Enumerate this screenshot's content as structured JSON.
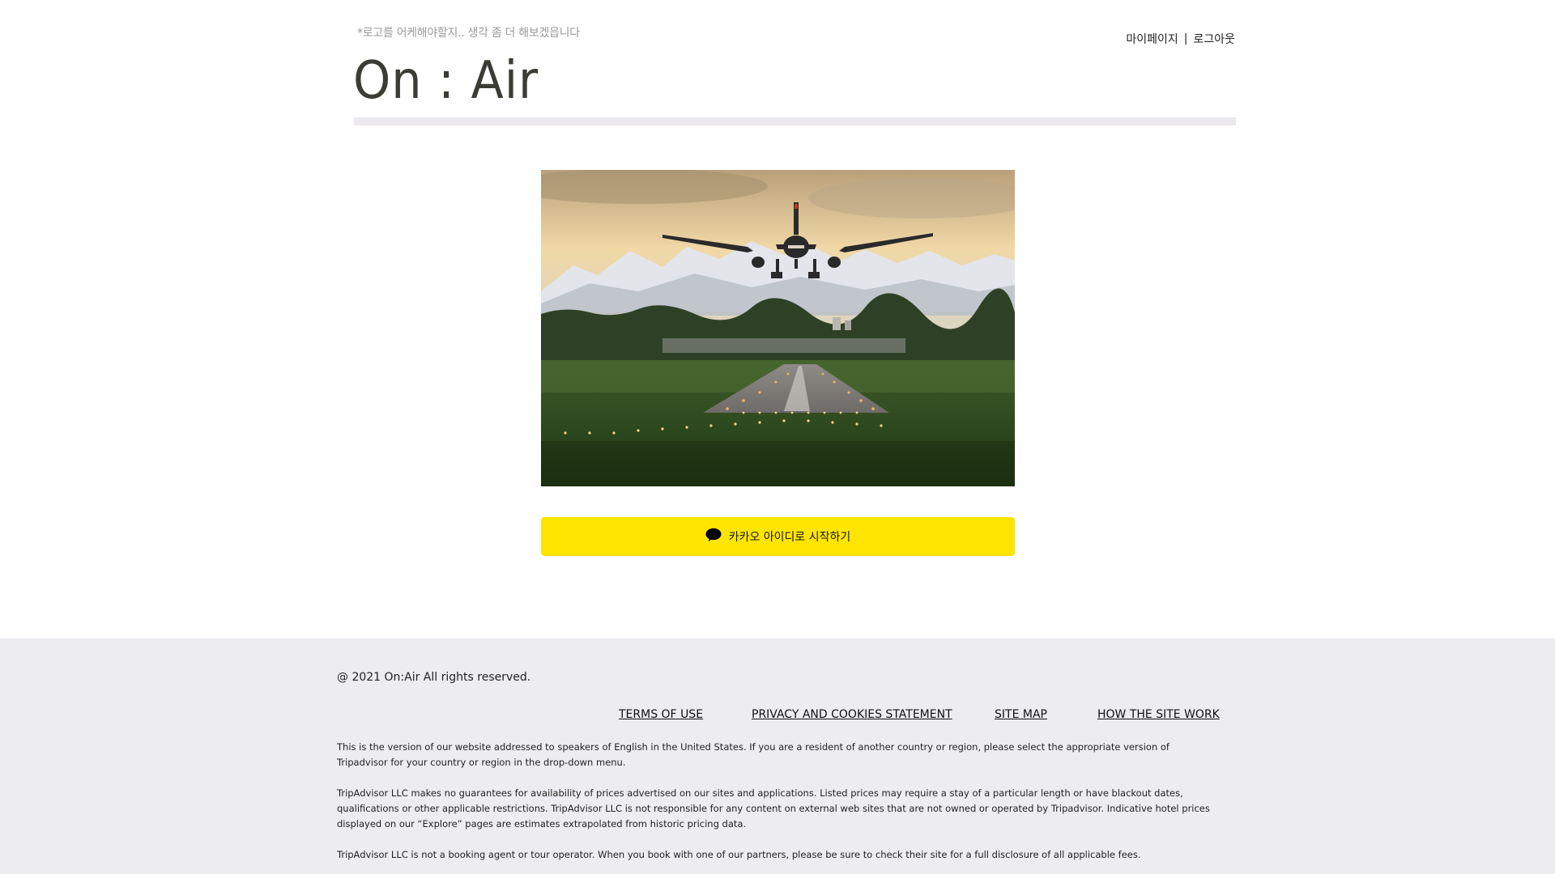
{
  "header": {
    "note": "*로고를 어케해야할지.. 생각 좀 더 해보겠읍니다",
    "logo": "On : Air",
    "mypage_label": "마이페이지",
    "separator": "|",
    "logout_label": "로그아웃"
  },
  "hero": {
    "icon": "airplane-landing-photo"
  },
  "login": {
    "kakao_label": "카카오 아이디로 시작하기",
    "icon": "speech-bubble-icon",
    "color": "#fee500"
  },
  "footer": {
    "copyright": "@ 2021 On:Air All rights reserved.",
    "links": [
      {
        "label": "TERMS OF USE"
      },
      {
        "label": "PRIVACY AND COOKIES STATEMENT"
      },
      {
        "label": "SITE MAP"
      },
      {
        "label": "HOW THE SITE WORK"
      }
    ],
    "legal": [
      "This is the version of our website addressed to speakers of English in the United States. If you are a resident of another country or region, please select the appropriate version of Tripadvisor for your country or region in the drop-down menu.",
      "TripAdvisor LLC makes no guarantees for availability of prices advertised on our sites and applications. Listed prices may require a stay of a particular length or have blackout dates, qualifications or other applicable restrictions. TripAdvisor LLC is not responsible for any content on external web sites that are not owned or operated by Tripadvisor. Indicative hotel prices displayed on our “Explore” pages are estimates extrapolated from historic pricing data.",
      "TripAdvisor LLC is not a booking agent or tour operator. When you book with one of our partners, please be sure to check their site for a full disclosure of all applicable fees."
    ],
    "background": "#edecf0"
  }
}
